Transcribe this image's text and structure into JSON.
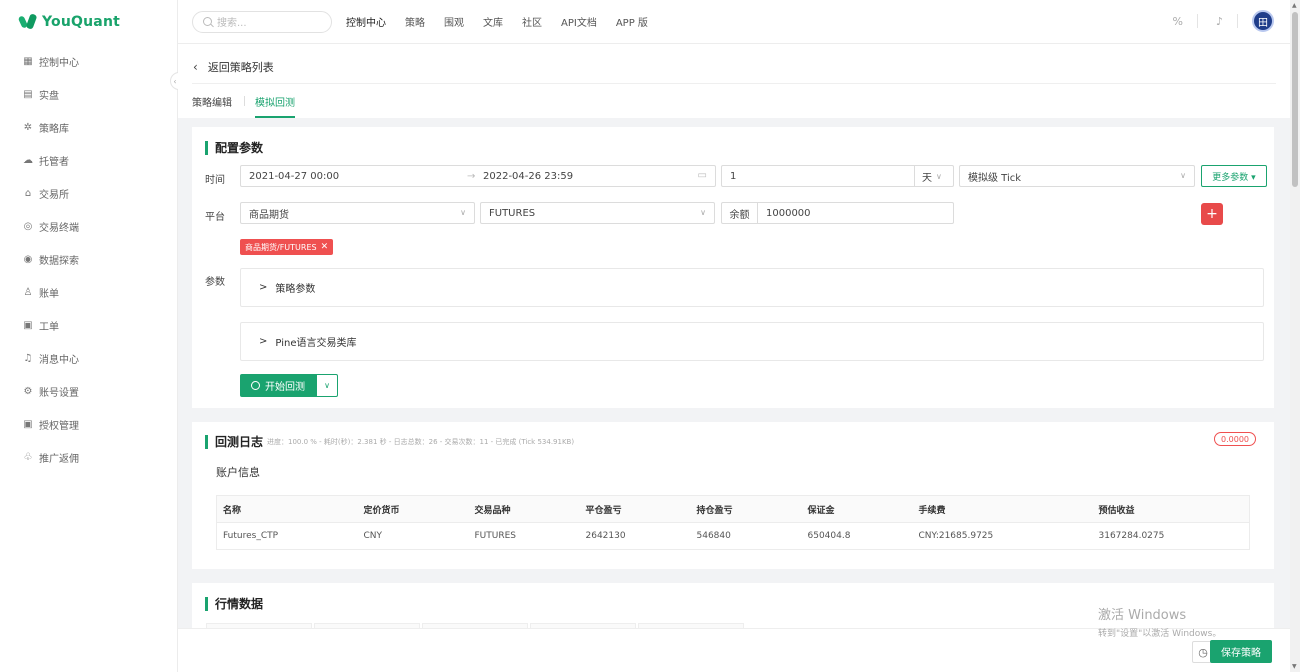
{
  "app": {
    "logo_text": "YouQuant"
  },
  "sidebar": {
    "items": [
      {
        "label": "控制中心",
        "icon": "dashboard-icon"
      },
      {
        "label": "实盘",
        "icon": "list-icon"
      },
      {
        "label": "策略库",
        "icon": "strategy-icon"
      },
      {
        "label": "托管者",
        "icon": "cloud-icon"
      },
      {
        "label": "交易所",
        "icon": "bank-icon"
      },
      {
        "label": "交易终端",
        "icon": "terminal-icon"
      },
      {
        "label": "数据探索",
        "icon": "explore-icon"
      },
      {
        "label": "账单",
        "icon": "bill-icon"
      },
      {
        "label": "工单",
        "icon": "ticket-icon"
      },
      {
        "label": "消息中心",
        "icon": "bell-icon"
      },
      {
        "label": "账号设置",
        "icon": "gear-icon"
      },
      {
        "label": "授权管理",
        "icon": "auth-icon"
      },
      {
        "label": "推广返佣",
        "icon": "gift-icon"
      }
    ]
  },
  "topbar": {
    "search_placeholder": "搜索...",
    "menu": [
      "控制中心",
      "策略",
      "围观",
      "文库",
      "社区",
      "API文档",
      "APP 版"
    ],
    "avatar_text": "田"
  },
  "header": {
    "back_label": "返回策略列表",
    "tabs": [
      "策略编辑",
      "模拟回测"
    ]
  },
  "config": {
    "title": "配置参数",
    "time_label": "时间",
    "start_time": "2021-04-27 00:00",
    "arrow": "→",
    "end_time": "2022-04-26 23:59",
    "period_value": "1",
    "period_unit": "天",
    "tick_mode": "模拟级 Tick",
    "more_params": "更多参数 ▾",
    "platform_label": "平台",
    "platform_value": "商品期货",
    "exchange_value": "FUTURES",
    "balance_label": "余额",
    "balance_value": "1000000",
    "tag_label": "商品期货/FUTURES",
    "params_label": "参数",
    "strategy_params": "策略参数",
    "pine_lib": "Pine语言交易类库",
    "start_backtest": "开始回测"
  },
  "log": {
    "title": "回测日志",
    "meta": "进度：100.0 % - 耗时(秒)：2.381 秒 - 日志总数：26 - 交易次数：11 - 已完成 (Tick 534.91KB)",
    "badge": "0.0000",
    "account_info": "账户信息",
    "columns": [
      "名称",
      "定价货币",
      "交易品种",
      "平仓盈亏",
      "持仓盈亏",
      "保证金",
      "手续费",
      "预估收益"
    ],
    "rows": [
      [
        "Futures_CTP",
        "CNY",
        "FUTURES",
        "2642130",
        "546840",
        "650404.8",
        "CNY:21685.9725",
        "3167284.0275"
      ]
    ]
  },
  "market": {
    "title": "行情数据"
  },
  "watermark": {
    "line1": "激活 Windows",
    "line2": "转到\"设置\"以激活 Windows。"
  },
  "footer": {
    "save_label": "保存策略"
  }
}
